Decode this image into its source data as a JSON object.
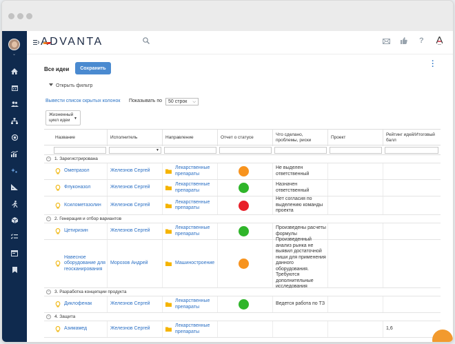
{
  "header": {
    "logo_text": "ADVANTA"
  },
  "toolbar": {
    "page_title": "Все идеи",
    "save_label": "Сохранить",
    "filter_label": "Открыть фильтр",
    "hidden_columns_label": "Вывести список скрытых колонок",
    "pager_prefix": "Показывать по",
    "pager_value": "50 строк",
    "lifecycle_select_line1": "Жизненный",
    "lifecycle_select_line2": "цикл идеи"
  },
  "table": {
    "columns": [
      "Название",
      "Исполнитель",
      "Направление",
      "Отчет о статусе",
      "Что сделано, проблемы, риски",
      "Проект",
      "Рейтинг идей/Итоговый балл"
    ],
    "groups": [
      {
        "label": "1. Зарегистрирована",
        "rows": [
          {
            "name": "Омепразол",
            "assignee": "Железнов Сергей",
            "direction": "Лекарственные препараты",
            "status": "orange",
            "notes": "Не выделен ответственный",
            "project": "",
            "rating": ""
          },
          {
            "name": "Флуконазол",
            "assignee": "Железнов Сергей",
            "direction": "Лекарственные препараты",
            "status": "green",
            "notes": "Назначен ответственный",
            "project": "",
            "rating": ""
          },
          {
            "name": "Ксилометазолин",
            "assignee": "Железнов Сергей",
            "direction": "Лекарственные препараты",
            "status": "red",
            "notes": "Нет согласия по выделению команды проекта",
            "project": "",
            "rating": ""
          }
        ]
      },
      {
        "label": "2. Генерация и отбор вариантов",
        "rows": [
          {
            "name": "Цетиризин",
            "assignee": "Железнов Сергей",
            "direction": "Лекарственные препараты",
            "status": "green",
            "notes": "Произведены расчеты формулы",
            "project": "",
            "rating": ""
          },
          {
            "name": "Навесное оборудование для геосканирования",
            "assignee": "Морозов Андрей",
            "direction": "Машиностроение",
            "status": "orange",
            "notes": "Произведенный анализ рынка не выявил достаточной ниши для применения данного оборудования. Требуются дополнительные исследования",
            "project": "",
            "rating": ""
          }
        ]
      },
      {
        "label": "3. Разработка концепции продукта",
        "rows": [
          {
            "name": "Диклофенак",
            "assignee": "Железнов Сергей",
            "direction": "Лекарственные препараты",
            "status": "green",
            "notes": "Ведется работа по ТЗ",
            "project": "",
            "rating": ""
          }
        ]
      },
      {
        "label": "4. Защита",
        "rows": [
          {
            "name": "Азимамед",
            "assignee": "Железнов Сергей",
            "direction": "Лекарственные препараты",
            "status": "",
            "notes": "",
            "project": "",
            "rating": "1,6"
          }
        ]
      }
    ]
  },
  "colors": {
    "sidebar": "#0f2a4e",
    "accent": "#4a8ad0",
    "link": "#2a6fc4",
    "status_green": "#2fb52a",
    "status_orange": "#f7931e",
    "status_red": "#e8202a",
    "folder": "#f5b400",
    "bulb": "#f1b814"
  },
  "icons": {
    "sidebar": [
      "home-icon",
      "calendar-icon",
      "users-icon",
      "org-structure-icon",
      "target-icon",
      "chart-icon",
      "sparkle-icon",
      "ruler-icon",
      "runner-icon",
      "cube-icon",
      "checklist-icon",
      "window-icon",
      "bookmark-icon"
    ],
    "header": [
      "menu-icon",
      "search-icon",
      "mail-icon",
      "like-icon",
      "help-icon",
      "advanta-a-icon"
    ]
  }
}
